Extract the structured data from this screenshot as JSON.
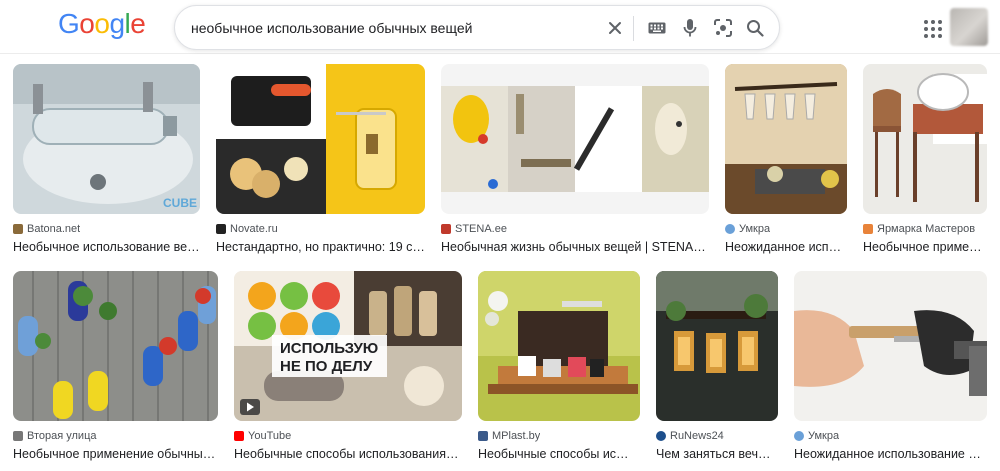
{
  "header": {
    "logo_letters": [
      {
        "ch": "G",
        "color": "#4285F4"
      },
      {
        "ch": "o",
        "color": "#EA4335"
      },
      {
        "ch": "o",
        "color": "#FBBC05"
      },
      {
        "ch": "g",
        "color": "#4285F4"
      },
      {
        "ch": "l",
        "color": "#34A853"
      },
      {
        "ch": "e",
        "color": "#EA4335"
      }
    ],
    "search_query": "необычное использование обычных вещей",
    "icons": [
      "close-icon",
      "keyboard-icon",
      "microphone-icon",
      "lens-icon",
      "search-icon"
    ]
  },
  "results": [
    {
      "source": "Batona.net",
      "title": "Необычное использование ве…",
      "favicon_color": "#8a6a3a"
    },
    {
      "source": "Novate.ru",
      "title": "Нестандартно, но практично: 19 с…",
      "favicon_color": "#222222"
    },
    {
      "source": "STENA.ee",
      "title": "Необычная жизнь обычных вещей | STENA.ee",
      "favicon_color": "#c0392b"
    },
    {
      "source": "Умкра",
      "title": "Неожиданное исп…",
      "favicon_color": "#6aa0d8"
    },
    {
      "source": "Ярмарка Мастеров",
      "title": "Необычное приме…",
      "favicon_color": "#e8833a"
    },
    {
      "source": "Вторая улица",
      "title": "Необычное применение обычны…",
      "favicon_color": "#777777"
    },
    {
      "source": "YouTube",
      "title": "Необычные способы использования…",
      "favicon_color": "#ff0000"
    },
    {
      "source": "MPlast.by",
      "title": "Необычные способы ис…",
      "favicon_color": "#3b5a8a"
    },
    {
      "source": "RuNews24",
      "title": "Чем заняться веч…",
      "favicon_color": "#1d4f8c"
    },
    {
      "source": "Умкра",
      "title": "Неожиданное использование …",
      "favicon_color": "#6aa0d8"
    }
  ],
  "thumb_overlay_text": [
    "ИСПОЛЬЗУЮ",
    "НЕ ПО ДЕЛУ"
  ],
  "watermark_text": "CUBE",
  "colors": {
    "accent": "#1a73e8",
    "text": "#202124",
    "muted": "#4d5156"
  }
}
